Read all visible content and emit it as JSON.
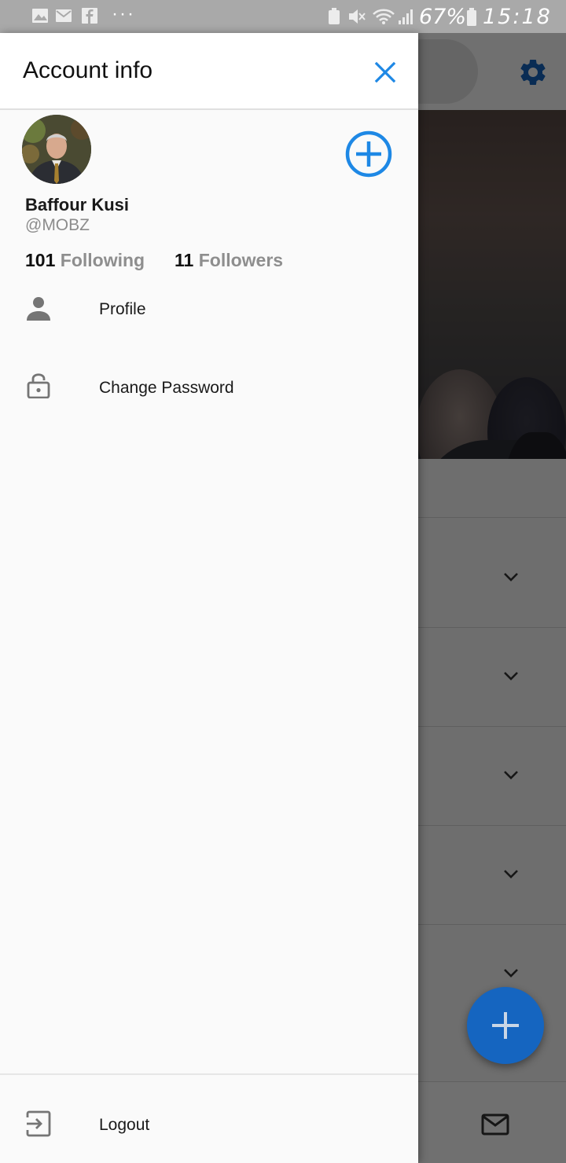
{
  "status_bar": {
    "notification_icons": [
      "gallery-icon",
      "mail-icon",
      "facebook-icon"
    ],
    "overflow": "···",
    "battery_percent": "67%",
    "time": "15:18"
  },
  "drawer": {
    "title": "Account info",
    "close_icon": "close-icon",
    "add_account_icon": "add-circle-icon",
    "user": {
      "name": "Baffour Kusi",
      "handle": "@MOBZ"
    },
    "stats": {
      "following_count": "101",
      "following_label": "Following",
      "followers_count": "11",
      "followers_label": "Followers"
    },
    "menu": [
      {
        "label": "Profile",
        "icon": "person-icon"
      },
      {
        "label": "Change Password",
        "icon": "lock-icon"
      }
    ],
    "footer": {
      "label": "Logout",
      "icon": "logout-icon"
    }
  },
  "background": {
    "settings_icon": "settings-gear-icon",
    "fab_icon": "plus-icon",
    "bottom_icon": "mail-icon",
    "list_expand_icon": "chevron-down-icon",
    "list_rows": 5
  },
  "colors": {
    "accent": "#1e88e5",
    "fab": "#1565c0",
    "status_bar": "#a9a9a9",
    "drawer_bg": "#fafafa",
    "muted_text": "#8e8e8e"
  }
}
